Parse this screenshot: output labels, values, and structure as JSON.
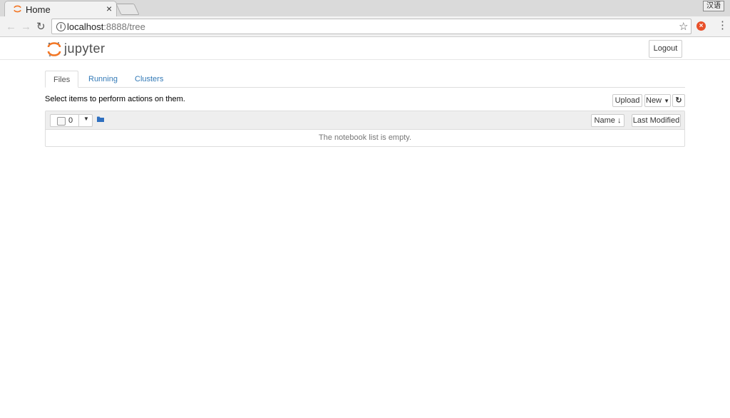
{
  "browser": {
    "tab_title": "Home",
    "tab_close": "×",
    "ime_label": "汉语",
    "url_host": "localhost",
    "url_rest": ":8888/tree"
  },
  "header": {
    "logo_text": "jupyter",
    "logout_label": "Logout"
  },
  "tabs": [
    {
      "label": "Files",
      "active": true
    },
    {
      "label": "Running",
      "active": false
    },
    {
      "label": "Clusters",
      "active": false
    }
  ],
  "toolbar": {
    "hint": "Select items to perform actions on them.",
    "upload_label": "Upload",
    "new_label": "New"
  },
  "list": {
    "selected_count": "0",
    "sort_name_label": "Name",
    "sort_modified_label": "Last Modified",
    "empty_message": "The notebook list is empty."
  },
  "colors": {
    "jupyter_orange": "#f37726",
    "link_blue": "#337ab7",
    "folder_blue": "#2f6fbf"
  }
}
